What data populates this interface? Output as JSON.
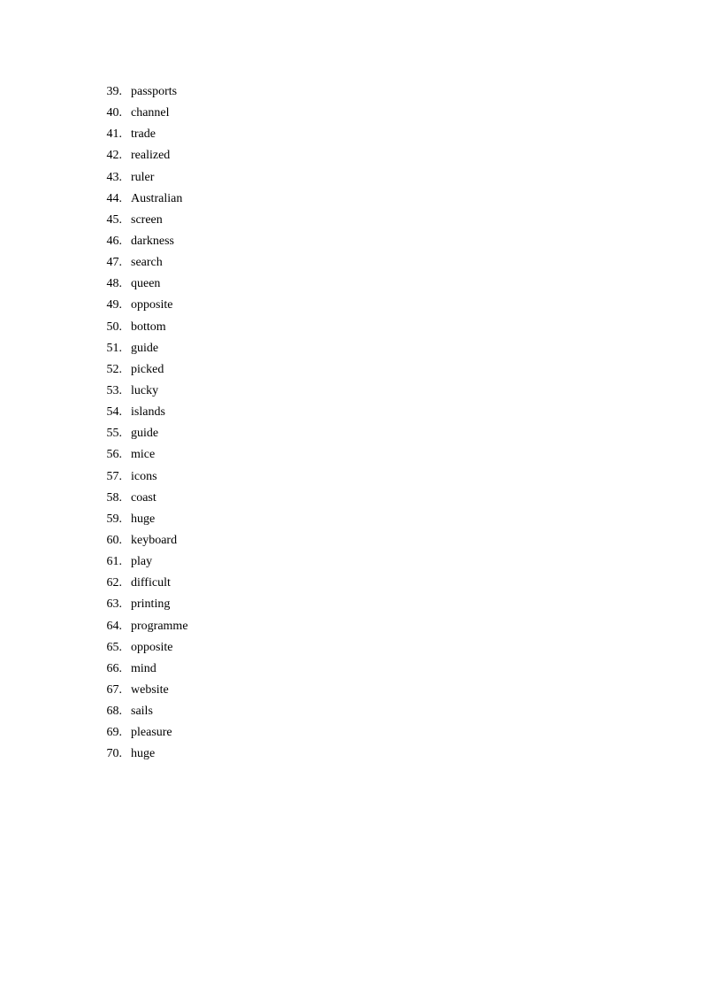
{
  "document": {
    "items": [
      {
        "number": "39.",
        "word": "passports"
      },
      {
        "number": "40.",
        "word": "channel"
      },
      {
        "number": "41.",
        "word": "trade"
      },
      {
        "number": "42.",
        "word": "realized"
      },
      {
        "number": "43.",
        "word": "ruler"
      },
      {
        "number": "44.",
        "word": "Australian"
      },
      {
        "number": "45.",
        "word": "screen"
      },
      {
        "number": "46.",
        "word": "darkness"
      },
      {
        "number": "47.",
        "word": "search"
      },
      {
        "number": "48.",
        "word": "queen"
      },
      {
        "number": "49.",
        "word": "opposite"
      },
      {
        "number": "50.",
        "word": "bottom"
      },
      {
        "number": "51.",
        "word": "guide"
      },
      {
        "number": "52.",
        "word": "picked"
      },
      {
        "number": "53.",
        "word": "lucky"
      },
      {
        "number": "54.",
        "word": "islands"
      },
      {
        "number": "55.",
        "word": "guide"
      },
      {
        "number": "56.",
        "word": "mice"
      },
      {
        "number": "57.",
        "word": "icons"
      },
      {
        "number": "58.",
        "word": "coast"
      },
      {
        "number": "59.",
        "word": "huge"
      },
      {
        "number": "60.",
        "word": "keyboard"
      },
      {
        "number": "61.",
        "word": "play"
      },
      {
        "number": "62.",
        "word": "difficult"
      },
      {
        "number": "63.",
        "word": "printing"
      },
      {
        "number": "64.",
        "word": "programme"
      },
      {
        "number": "65.",
        "word": "opposite"
      },
      {
        "number": "66.",
        "word": "mind"
      },
      {
        "number": "67.",
        "word": "website"
      },
      {
        "number": "68.",
        "word": "sails"
      },
      {
        "number": "69.",
        "word": "pleasure"
      },
      {
        "number": "70.",
        "word": "huge"
      }
    ]
  }
}
